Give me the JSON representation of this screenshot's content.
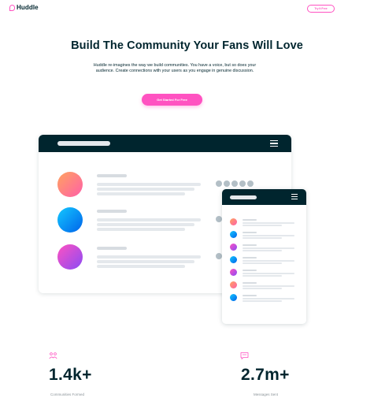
{
  "header": {
    "logo_text": "Huddle",
    "try_button_label": "Try It Free"
  },
  "hero": {
    "title": "Build The Community Your Fans Will Love",
    "description": "Huddle re-imagines the way we build communities. You have a voice, but so does your audience. Create connections with your users as you engage in genuine discussion.",
    "cta_label": "Get Started For Free"
  },
  "mockup": {
    "avatars": [
      "orange-pink-gradient",
      "cyan-blue-gradient",
      "pink-purple-gradient"
    ],
    "mini_avatars": [
      "orange-pink",
      "cyan-blue",
      "pink-purple",
      "cyan-blue",
      "pink-purple",
      "orange-pink",
      "cyan-blue"
    ]
  },
  "stats": [
    {
      "icon": "communities-icon",
      "number": "1.4k+",
      "label": "Communities Formed"
    },
    {
      "icon": "messages-icon",
      "number": "2.7m+",
      "label": "Messages Sent"
    }
  ],
  "colors": {
    "accent_pink": "#ff52c1",
    "dark_navy": "#00252e",
    "placeholder_gray": "#e4e8ec",
    "dot_gray": "#b3bfc6"
  }
}
